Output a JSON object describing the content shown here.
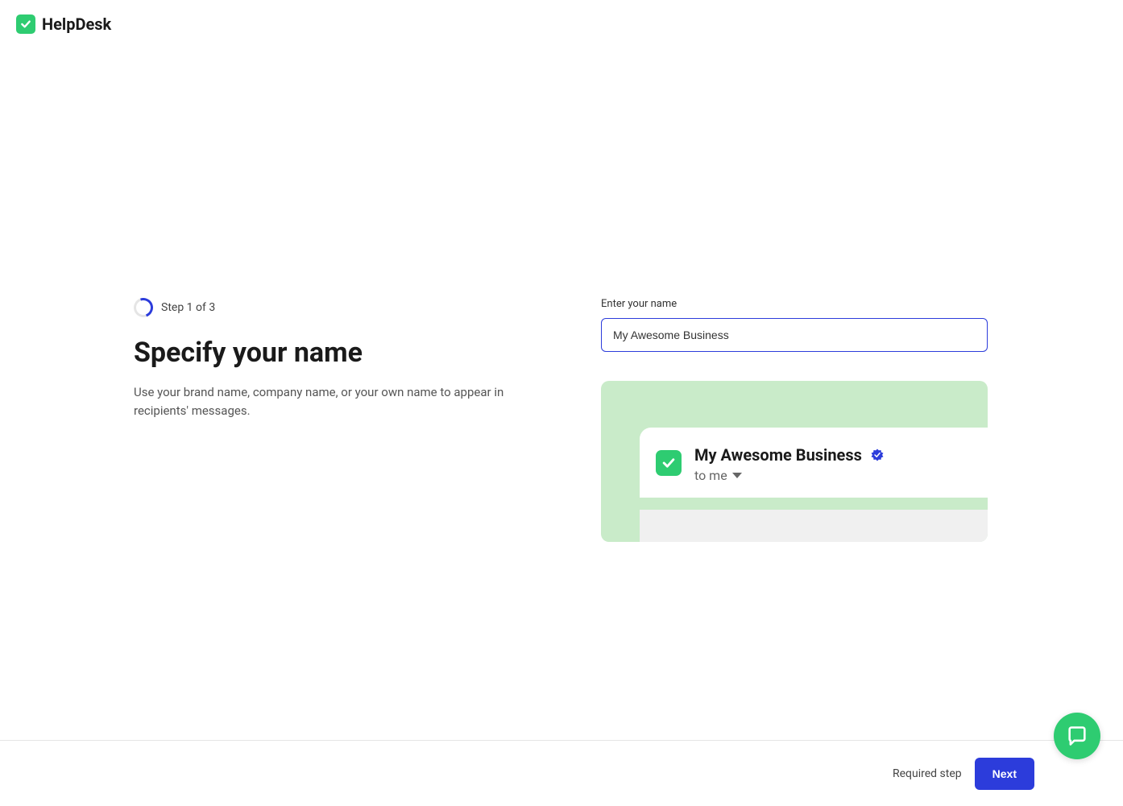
{
  "header": {
    "brand": "HelpDesk"
  },
  "step": {
    "label": "Step 1 of 3"
  },
  "page": {
    "title": "Specify your name",
    "subtitle": "Use your brand name, company name, or your own name to appear in recipients' messages."
  },
  "form": {
    "name_label": "Enter your name",
    "name_value": "My Awesome Business"
  },
  "preview": {
    "business_name": "My Awesome Business",
    "recipient_line": "to me"
  },
  "footer": {
    "required_label": "Required step",
    "next_label": "Next"
  }
}
